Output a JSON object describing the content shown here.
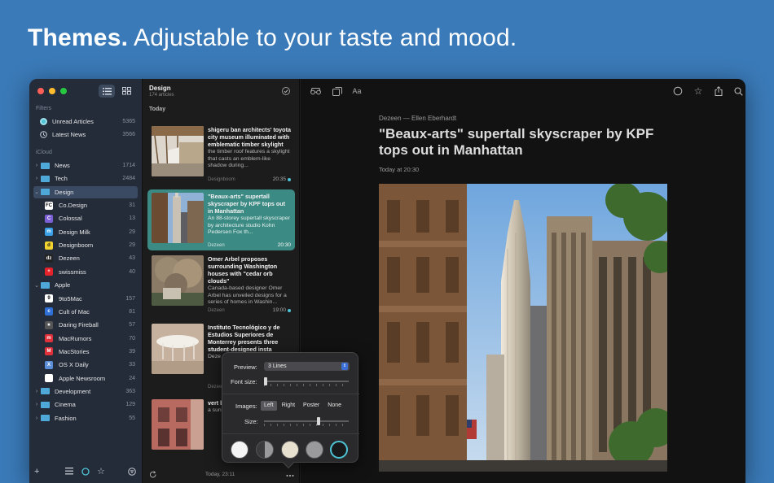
{
  "headline": {
    "bold": "Themes.",
    "rest": "Adjustable to your taste and mood."
  },
  "sidebar": {
    "filters_label": "Filters",
    "filters": [
      {
        "label": "Unread Articles",
        "count": "5365",
        "icon": "unread-icon"
      },
      {
        "label": "Latest News",
        "count": "3566",
        "icon": "clock-icon"
      }
    ],
    "icloud_label": "iCloud",
    "items": [
      {
        "label": "News",
        "count": "1714",
        "type": "folder",
        "expand": "collapsed"
      },
      {
        "label": "Tech",
        "count": "2484",
        "type": "folder",
        "expand": "collapsed"
      },
      {
        "label": "Design",
        "count": "",
        "type": "folder",
        "expand": "expanded",
        "selected": true
      },
      {
        "label": "Co.Design",
        "count": "31",
        "type": "feed",
        "color": "#ffffff",
        "glyph": "FC"
      },
      {
        "label": "Colossal",
        "count": "13",
        "type": "feed",
        "color": "#7b5fd6",
        "glyph": "C"
      },
      {
        "label": "Design Milk",
        "count": "29",
        "type": "feed",
        "color": "#3aa0e8",
        "glyph": "m"
      },
      {
        "label": "Designboom",
        "count": "29",
        "type": "feed",
        "color": "#f2d22e",
        "glyph": "d"
      },
      {
        "label": "Dezeen",
        "count": "43",
        "type": "feed",
        "color": "#222222",
        "glyph": "dz"
      },
      {
        "label": "swissmiss",
        "count": "40",
        "type": "feed",
        "color": "#e3222a",
        "glyph": "+"
      },
      {
        "label": "Apple",
        "count": "",
        "type": "folder",
        "expand": "expanded"
      },
      {
        "label": "9to5Mac",
        "count": "157",
        "type": "feed",
        "color": "#ffffff",
        "glyph": "9"
      },
      {
        "label": "Cult of Mac",
        "count": "81",
        "type": "feed",
        "color": "#2f6fd8",
        "glyph": "c"
      },
      {
        "label": "Daring Fireball",
        "count": "57",
        "type": "feed",
        "color": "#555555",
        "glyph": "★"
      },
      {
        "label": "MacRumors",
        "count": "70",
        "type": "feed",
        "color": "#e0303a",
        "glyph": "m"
      },
      {
        "label": "MacStories",
        "count": "39",
        "type": "feed",
        "color": "#e0303a",
        "glyph": "M"
      },
      {
        "label": "OS X Daily",
        "count": "33",
        "type": "feed",
        "color": "#5a8fd8",
        "glyph": "X"
      },
      {
        "label": "Apple Newsroom",
        "count": "24",
        "type": "feed",
        "color": "#ffffff",
        "glyph": ""
      },
      {
        "label": "Development",
        "count": "363",
        "type": "folder",
        "expand": "collapsed"
      },
      {
        "label": "Cinema",
        "count": "129",
        "type": "folder",
        "expand": "collapsed"
      },
      {
        "label": "Fashion",
        "count": "55",
        "type": "folder",
        "expand": "collapsed"
      }
    ]
  },
  "list": {
    "title": "Design",
    "subtitle": "174 articles",
    "section": "Today",
    "footer": "Today, 23:11",
    "articles": [
      {
        "title": "shigeru ban architects' toyota city museum illuminated with emblematic timber skylight",
        "body": "the timber roof features a skylight that casts an emblem-like shadow during...",
        "source": "Designboom",
        "time": "20:35",
        "unread": true
      },
      {
        "title": "\"Beaux-arts\" supertall skyscraper by KPF tops out in Manhattan",
        "body": "An 88-storey supertall skyscraper by architecture studio Kohn Pedersen Fox th...",
        "source": "Dezeen",
        "time": "20:30",
        "unread": false,
        "selected": true
      },
      {
        "title": "Omer Arbel proposes surrounding Washington houses with \"cedar orb clouds\"",
        "body": "Canada-based designer Omer Arbel has unveiled designs for a series of homes in Washin...",
        "source": "Dezeen",
        "time": "19:00",
        "unread": true
      },
      {
        "title": "Instituto Tecnológico y de Estudios Superiores de Monterrey presents three student-designed insta",
        "body": "Deze patte",
        "source": "Dezeen",
        "time": "",
        "unread": false
      },
      {
        "title": "vert brick arch neth",
        "body": "a sun exter rowh",
        "source": "",
        "time": "",
        "unread": false
      }
    ]
  },
  "article": {
    "byline": "Dezeen — Ellen Eberhardt",
    "title": "\"Beaux-arts\" supertall skyscraper by KPF tops out in Manhattan",
    "date": "Today at 20:30"
  },
  "popover": {
    "preview_label": "Preview:",
    "preview_value": "3 Lines",
    "fontsize_label": "Font size:",
    "fontsize_level": 0.0,
    "images_label": "Images:",
    "image_options": [
      "Left",
      "Right",
      "Poster",
      "None"
    ],
    "image_selected": "Left",
    "size_label": "Size:",
    "size_level": 0.65,
    "themes": [
      "#f4f4f4",
      "#8a8a8a",
      "#e8e0cf",
      "#9a9a9c",
      "#18191a"
    ],
    "selected_theme_border": "#4ec3d6"
  },
  "colors": {
    "accent": "#3b8a83",
    "unread_dot": "#4ec3d6",
    "background": "#3a7ab8"
  }
}
